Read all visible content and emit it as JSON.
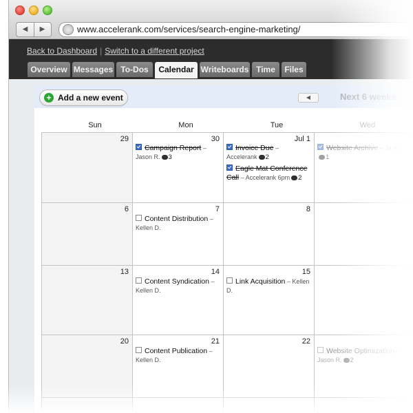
{
  "browser": {
    "url": "www.accelerank.com/services/search-engine-marketing/",
    "back_icon": "◀",
    "forward_icon": "▶"
  },
  "header": {
    "back_link": "Back to Dashboard",
    "separator": "|",
    "switch_link": "Switch to a different project"
  },
  "tabs": [
    "Overview",
    "Messages",
    "To-Dos",
    "Calendar",
    "Writeboards",
    "Time",
    "Files"
  ],
  "active_tab": "Calendar",
  "toolbar": {
    "add_event_label": "Add a new event",
    "add_icon": "+",
    "prev_icon": "◀",
    "next_label": "Next 6 weeks"
  },
  "calendar": {
    "day_headers": [
      "Sun",
      "Mon",
      "Tue",
      "Wed"
    ],
    "weeks": [
      {
        "days": [
          "29",
          "30",
          "Jul 1",
          ""
        ],
        "events": [
          {
            "title": "Campaign Report",
            "done": true,
            "suffix": " – Jason R.",
            "comments": "3"
          },
          {
            "title": "Invoice Due",
            "done": true,
            "suffix": " – Accelerank",
            "comments": "2"
          },
          {
            "title": "Eagle Mat Conference Call",
            "done": true,
            "suffix": " – Accelerank 6pm",
            "comments": "2"
          },
          {
            "title": "Website Archive",
            "done": true,
            "suffix": " – Ja R.",
            "comments": "1"
          }
        ]
      },
      {
        "days": [
          "6",
          "7",
          "8",
          ""
        ],
        "events": [
          {
            "title": "Content Distribution",
            "done": false,
            "suffix": " – Kellen D."
          }
        ]
      },
      {
        "days": [
          "13",
          "14",
          "15",
          ""
        ],
        "events": [
          {
            "title": "Content Syndication",
            "done": false,
            "suffix": " – Kellen D."
          },
          {
            "title": "Link Acquisition",
            "done": false,
            "suffix": " – Kellen D."
          }
        ]
      },
      {
        "days": [
          "20",
          "21",
          "22",
          ""
        ],
        "events": [
          {
            "title": "Content Publication",
            "done": false,
            "suffix": " – Kellen D."
          },
          {
            "title": "Website Optimization",
            "done": false,
            "suffix": " – Jason R.",
            "comments": "2"
          }
        ]
      }
    ]
  }
}
